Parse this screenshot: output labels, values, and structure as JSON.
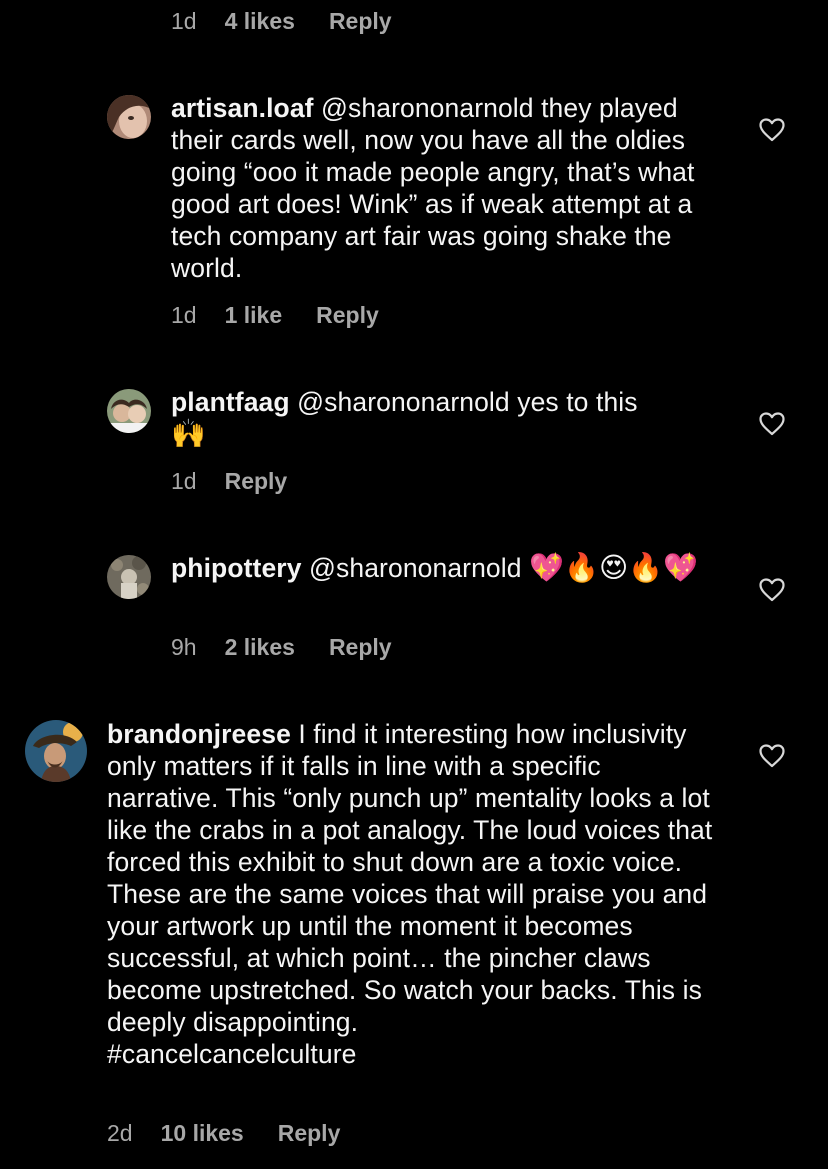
{
  "first_meta": {
    "time": "1d",
    "likes": "4 likes",
    "reply": "Reply"
  },
  "comments": [
    {
      "username": "artisan.loaf",
      "mention": "@sharononarnold",
      "text": " they played their cards well, now you have all the oldies going “ooo it made people angry, that’s what good art does! Wink” as if weak attempt at a tech company art fair was going shake the world.",
      "time": "1d",
      "likes": "1 like",
      "reply": "Reply"
    },
    {
      "username": "plantfaag",
      "mention": "@sharononarnold",
      "text": " yes to this",
      "emoji": "🙌",
      "time": "1d",
      "reply": "Reply"
    },
    {
      "username": "phipottery",
      "mention": "@sharononarnold",
      "emoji": "💖🔥😍🔥💖",
      "time": "9h",
      "likes": "2 likes",
      "reply": "Reply"
    },
    {
      "username": "brandonjreese",
      "text": " I find it interesting how inclusivity only matters if it falls in line with a specific narrative. This “only punch up” mentality looks a lot like the crabs in a pot analogy. The loud voices that forced this exhibit to shut down are a toxic voice. These are the same voices that will praise you and your artwork up until the moment it becomes successful, at which point… the pincher claws become upstretched. So watch your backs. This is deeply disappointing.",
      "hashtag": "#cancelcancelculture",
      "time": "2d",
      "likes": "10 likes",
      "reply": "Reply"
    }
  ],
  "icons": {
    "like": "heart-outline-icon"
  },
  "colors": {
    "background": "#000000",
    "text": "#f5f5f5",
    "meta": "#a8a8a8"
  }
}
